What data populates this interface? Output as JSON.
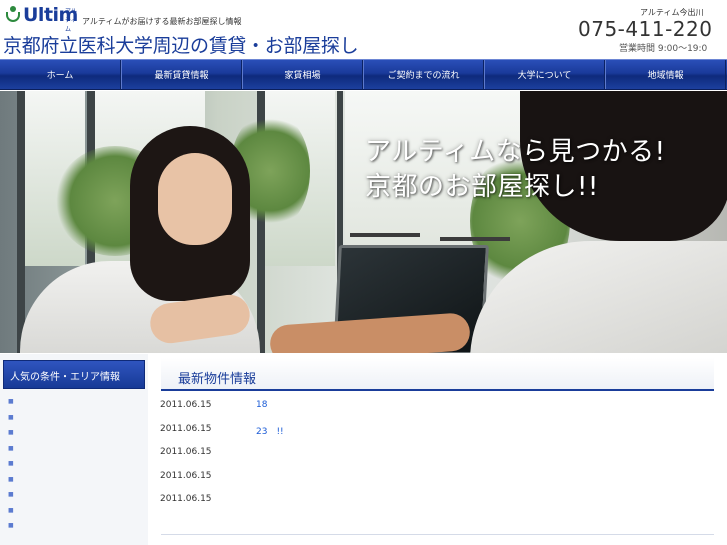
{
  "header": {
    "logo_text": "Ultim",
    "logo_small": "アルティム",
    "tagline": "アルティムがお届けする最新お部屋探し情報",
    "site_title": "京都府立医科大学周辺の賃貸・お部屋探し",
    "shop_name": "アルティム今出川",
    "phone": "075-411-220",
    "hours": "営業時間 9:00〜19:0"
  },
  "nav": {
    "items": [
      {
        "label": "ホーム"
      },
      {
        "label": "最新賃貸情報"
      },
      {
        "label": "家賃相場"
      },
      {
        "label": "ご契約までの流れ"
      },
      {
        "label": "大学について"
      },
      {
        "label": "地域情報"
      }
    ]
  },
  "hero": {
    "line1": "アルティムなら見つかる!",
    "line2": "京都のお部屋探し!!"
  },
  "sidebar": {
    "title": "人気の条件・エリア情報",
    "bullet": "■",
    "items": [
      "",
      "",
      "",
      "",
      "",
      "",
      "",
      "",
      ""
    ]
  },
  "main": {
    "heading": "最新物件情報",
    "news": [
      {
        "date": "2011.06.15",
        "text": "18"
      },
      {
        "date": "2011.06.15",
        "text": "23　!!"
      },
      {
        "date": "2011.06.15",
        "text": ""
      },
      {
        "date": "2011.06.15",
        "text": ""
      },
      {
        "date": "2011.06.15",
        "text": ""
      }
    ]
  },
  "colors": {
    "brand_blue": "#1a3d9a",
    "nav_blue": "#1a3a9a",
    "link_blue": "#1a5bd6",
    "logo_green": "#2d8a3e"
  }
}
